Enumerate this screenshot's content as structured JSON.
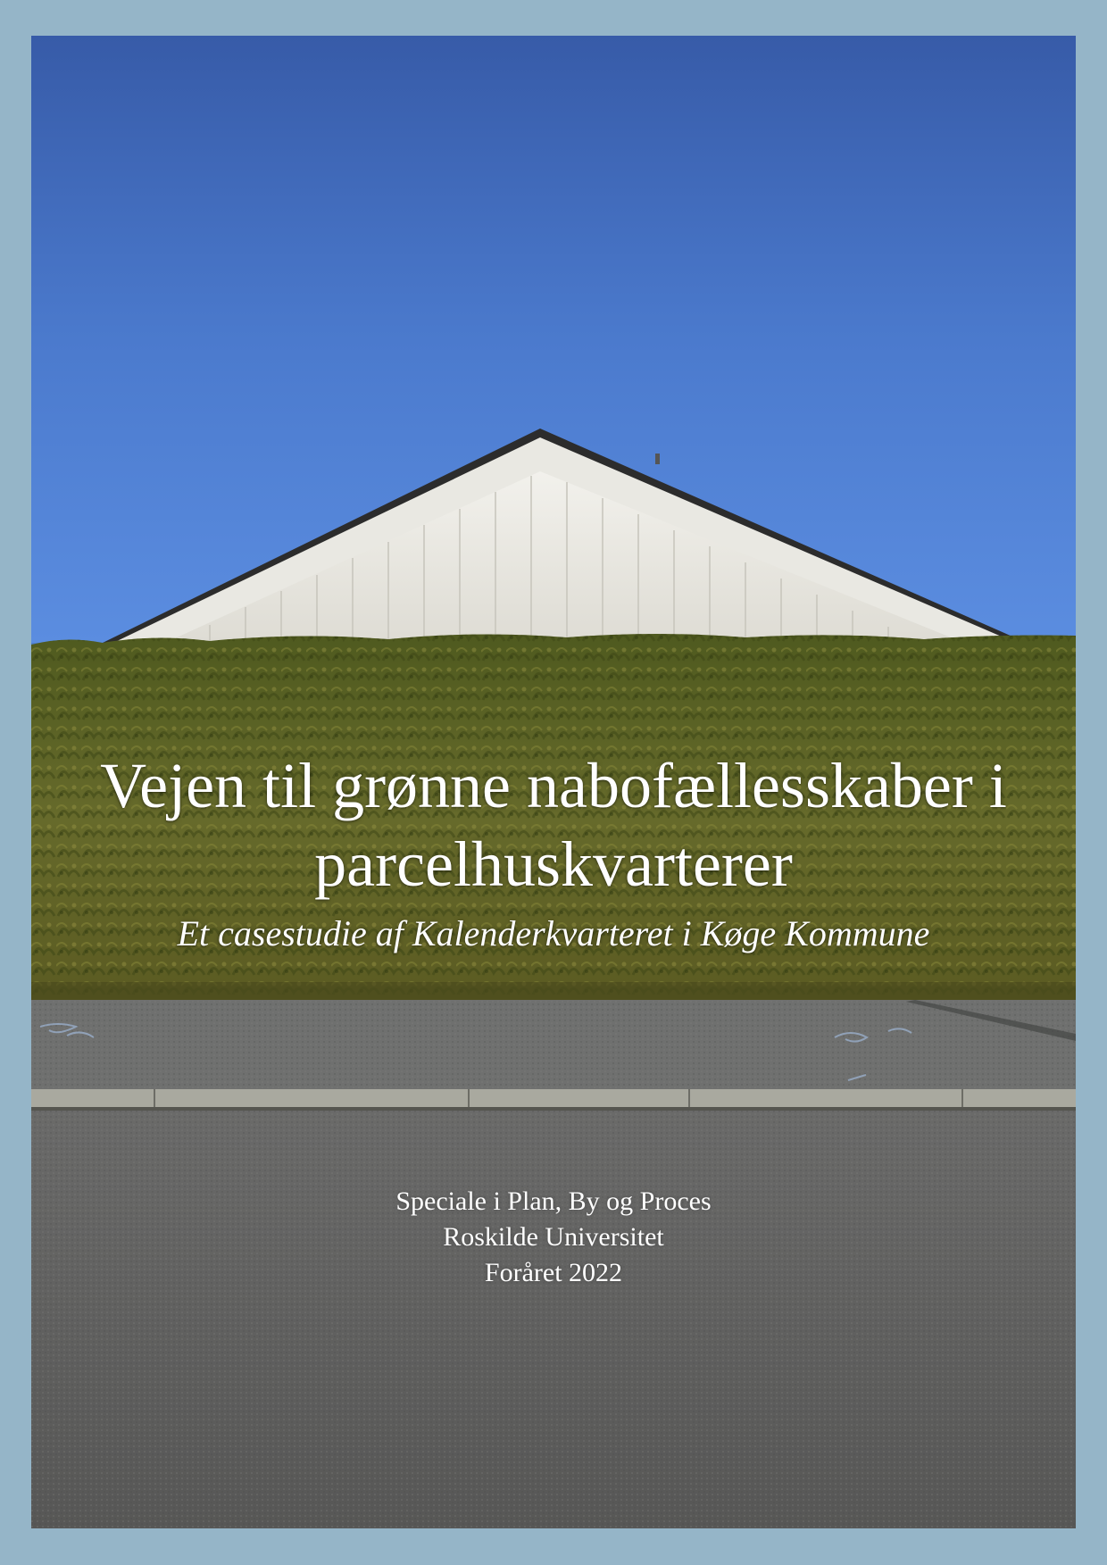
{
  "cover": {
    "title_line_1": "Vejen til grønne nabofællesskaber i",
    "title_line_2": "parcelhuskvarterer",
    "subtitle": "Et casestudie af Kalenderkvarteret i Køge Kommune",
    "program": "Speciale i Plan, By og Proces",
    "university": "Roskilde Universitet",
    "semester": "Foråret 2022"
  },
  "colors": {
    "frame": "#95b5c8",
    "sky_top": "#3a60ab",
    "sky_bottom": "#5688dd",
    "house_wall": "#ecebe6",
    "hedge": "#5f6428",
    "sidewalk": "#707170",
    "curb": "#a7a79c",
    "road": "#5d5d5c",
    "text": "#ffffff"
  },
  "icons": {
    "cover_photo": "house-behind-hedge-photo"
  }
}
